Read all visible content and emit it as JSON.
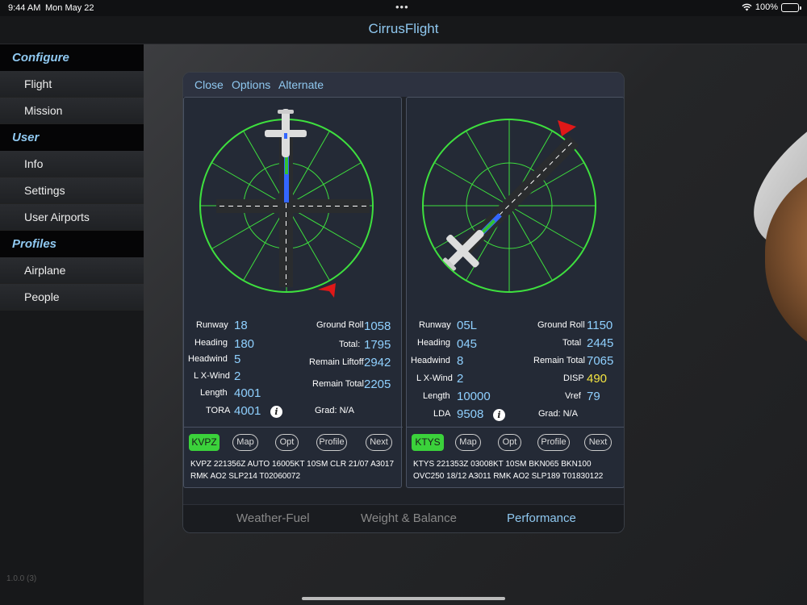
{
  "status": {
    "time": "9:44 AM",
    "date": "Mon May 22",
    "dots": "•••",
    "battery": "100%",
    "battery_level": 1.0
  },
  "app": {
    "title": "CirrusFlight"
  },
  "sidebar": {
    "sections": [
      {
        "label": "Configure",
        "items": [
          "Flight",
          "Mission"
        ]
      },
      {
        "label": "User",
        "items": [
          "Info",
          "Settings",
          "User Airports"
        ]
      },
      {
        "label": "Profiles",
        "items": [
          "Airplane",
          "People"
        ]
      }
    ],
    "version": "1.0.0 (3)"
  },
  "toolbar": {
    "close": "Close",
    "options": "Options",
    "alternate": "Alternate"
  },
  "departure": {
    "labels": {
      "runway": "Runway",
      "heading": "Heading",
      "headwind": "Headwind",
      "lxwind": "L X-Wind",
      "length": "Length",
      "tora": "TORA",
      "ground_roll": "Ground Roll",
      "total": "Total:",
      "remain_liftoff": "Remain Liftoff",
      "remain_total": "Remain Total",
      "grad": "Grad: N/A"
    },
    "values": {
      "runway": "18",
      "heading": "180",
      "headwind": "5",
      "lxwind": "2",
      "length": "4001",
      "tora": "4001",
      "ground_roll": "1058",
      "total": "1795",
      "remain_liftoff": "2942",
      "remain_total": "2205"
    },
    "airport": "KVPZ",
    "buttons": {
      "map": "Map",
      "opt": "Opt",
      "profile": "Profile",
      "next": "Next"
    },
    "metar": "KVPZ 221356Z AUTO 16005KT 10SM CLR 21/07 A3017 RMK AO2 SLP214 T02060072"
  },
  "arrival": {
    "labels": {
      "runway": "Runway",
      "heading": "Heading",
      "headwind": "Headwind",
      "lxwind": "L X-Wind",
      "length": "Length",
      "lda": "LDA",
      "ground_roll": "Ground Roll",
      "total": "Total",
      "remain_total": "Remain Total",
      "disp": "DISP",
      "vref": "Vref",
      "grad": "Grad: N/A"
    },
    "values": {
      "runway": "05L",
      "heading": "045",
      "headwind": "8",
      "lxwind": "2",
      "length": "10000",
      "lda": "9508",
      "ground_roll": "1150",
      "total": "2445",
      "remain_total": "7065",
      "disp": "490",
      "vref": "79"
    },
    "airport": "KTYS",
    "buttons": {
      "map": "Map",
      "opt": "Opt",
      "profile": "Profile",
      "next": "Next"
    },
    "metar": "KTYS 221353Z 03008KT 10SM BKN065 BKN100 OVC250 18/12 A3011 RMK AO2 SLP189 T01830122"
  },
  "tabs": {
    "weather": "Weather-Fuel",
    "weight": "Weight & Balance",
    "performance": "Performance",
    "active": "performance"
  },
  "colors": {
    "accent": "#8fc8f0",
    "dial": "#3ee03e",
    "wind_arrow": "#e01818",
    "value": "#8fd0ff",
    "warn": "#f5e642"
  }
}
